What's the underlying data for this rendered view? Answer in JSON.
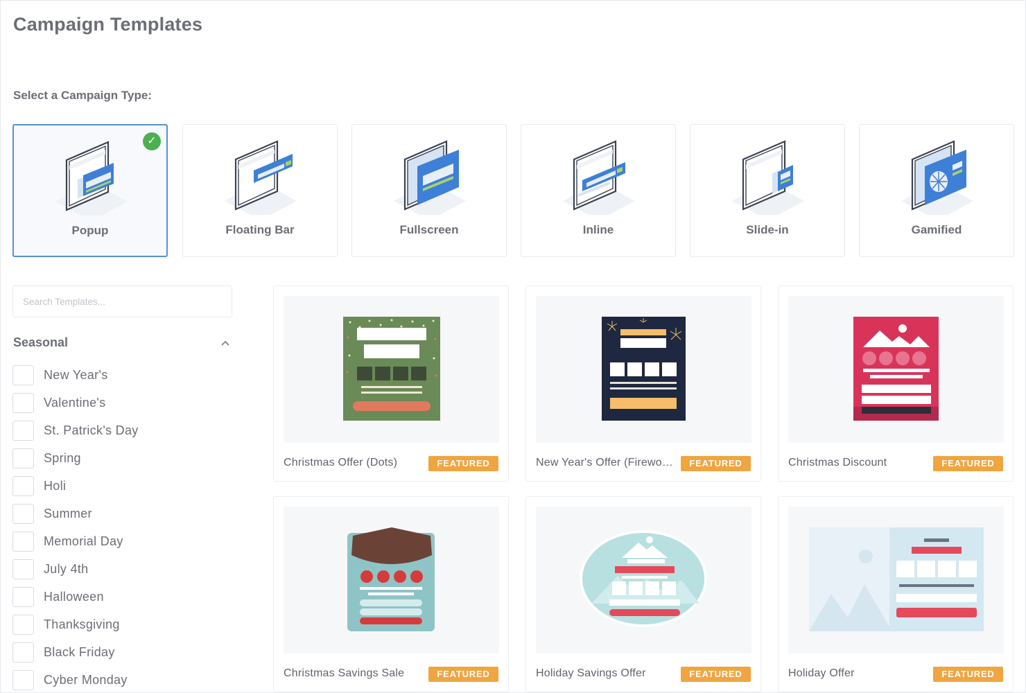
{
  "header": {
    "title": "Campaign Templates"
  },
  "campaign_types": {
    "label": "Select a Campaign Type:",
    "selected": "Popup",
    "items": [
      {
        "label": "Popup",
        "icon": "popup-icon"
      },
      {
        "label": "Floating Bar",
        "icon": "floating-bar-icon"
      },
      {
        "label": "Fullscreen",
        "icon": "fullscreen-icon"
      },
      {
        "label": "Inline",
        "icon": "inline-icon"
      },
      {
        "label": "Slide-in",
        "icon": "slide-in-icon"
      },
      {
        "label": "Gamified",
        "icon": "gamified-icon"
      }
    ],
    "check_glyph": "✓"
  },
  "search": {
    "placeholder": "Search Templates...",
    "value": ""
  },
  "filters": {
    "title": "Seasonal",
    "items": [
      {
        "label": "New Year's",
        "checked": false
      },
      {
        "label": "Valentine's",
        "checked": false
      },
      {
        "label": "St. Patrick's Day",
        "checked": false
      },
      {
        "label": "Spring",
        "checked": false
      },
      {
        "label": "Holi",
        "checked": false
      },
      {
        "label": "Summer",
        "checked": false
      },
      {
        "label": "Memorial Day",
        "checked": false
      },
      {
        "label": "July 4th",
        "checked": false
      },
      {
        "label": "Halloween",
        "checked": false
      },
      {
        "label": "Thanksgiving",
        "checked": false
      },
      {
        "label": "Black Friday",
        "checked": false
      },
      {
        "label": "Cyber Monday",
        "checked": false
      }
    ]
  },
  "templates": [
    {
      "name": "Christmas Offer (Dots)",
      "badge": "FEATURED"
    },
    {
      "name": "New Year's Offer (Fireworks)",
      "badge": "FEATURED"
    },
    {
      "name": "Christmas Discount",
      "badge": "FEATURED"
    },
    {
      "name": "Christmas Savings Sale",
      "badge": "FEATURED"
    },
    {
      "name": "Holiday Savings Offer",
      "badge": "FEATURED"
    },
    {
      "name": "Holiday Offer",
      "badge": "FEATURED"
    }
  ],
  "colors": {
    "accent": "#5a8fcc",
    "check": "#4caf50",
    "badge": "#f0a540",
    "dots_bg": "#6a8a58",
    "dots_button": "#e07a5c",
    "fireworks_bg": "#1e2840",
    "fireworks_accent": "#f6bd6a",
    "discount_bg": "#d8345a",
    "sale_top": "#6b4336",
    "sale_bg": "#8fc4c6",
    "sale_red": "#d63b3b",
    "holiday_teal": "#b8e0e0",
    "holiday_red": "#e44a5a"
  }
}
